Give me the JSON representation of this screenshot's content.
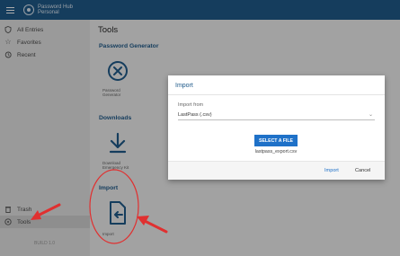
{
  "app": {
    "brand_line1": "Password Hub",
    "brand_line2": "Personal"
  },
  "sidebar": {
    "items": [
      {
        "label": "All Entries",
        "icon": "shield-icon"
      },
      {
        "label": "Favorites",
        "icon": "star-icon"
      },
      {
        "label": "Recent",
        "icon": "history-icon"
      },
      {
        "label": "Trash",
        "icon": "trash-icon"
      },
      {
        "label": "Tools",
        "icon": "tools-icon"
      }
    ],
    "version": "BUILD 1.0"
  },
  "main": {
    "title": "Tools",
    "sections": {
      "password_generator": {
        "title": "Password Generator",
        "caption_line1": "Password",
        "caption_line2": "Generator"
      },
      "downloads": {
        "title": "Downloads",
        "caption_line1": "Download",
        "caption_line2": "Emergency Kit"
      },
      "import": {
        "title": "Import",
        "caption_line1": "Import"
      }
    }
  },
  "dialog": {
    "title": "Import",
    "import_from_label": "Import from",
    "import_from_value": "LastPass (.csv)",
    "select_file_label": "SELECT A FILE",
    "selected_file": "lastpass_export.csv",
    "import_button": "Import",
    "cancel_button": "Cancel"
  },
  "colors": {
    "header": "#1f5a8a",
    "accent": "#1f71c8",
    "annotation": "#e03030"
  }
}
